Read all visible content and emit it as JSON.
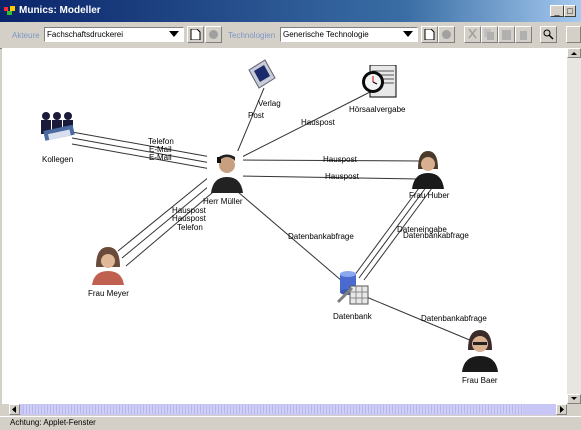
{
  "window": {
    "title": "Munics: Modeller",
    "min": "_",
    "max": "□",
    "close": "X"
  },
  "toolbar": {
    "akteure_label": "Akteure",
    "akteure_value": "Fachschaftsdruckerei",
    "technologien_label": "Technologien",
    "technologien_value": "Generische Technologie"
  },
  "nodes": {
    "kollegen": "Kollegen",
    "verlag": "Verlag",
    "hoersaal": "Hörsaalvergabe",
    "mueller": "Herr Müller",
    "huber": "Frau Huber",
    "meyer": "Frau Meyer",
    "datenbank": "Datenbank",
    "baer": "Frau Baer"
  },
  "edges": {
    "post": "Post",
    "hauspost_hoersaal": "Hauspost",
    "telefon1": "Telefon",
    "email1": "E-Mail",
    "email2": "E-Mail",
    "hauspost_huber1": "Hauspost",
    "hauspost_huber2": "Hauspost",
    "hauspost_meyer1": "Hauspost",
    "hauspost_meyer2": "Hauspost",
    "telefon_meyer": "Telefon",
    "db_mueller": "Datenbankabfrage",
    "dateneingabe": "Dateneingabe",
    "db_huber": "Datenbankabfrage",
    "db_baer": "Datenbankabfrage"
  },
  "status": {
    "text": "Achtung: Applet-Fenster"
  }
}
